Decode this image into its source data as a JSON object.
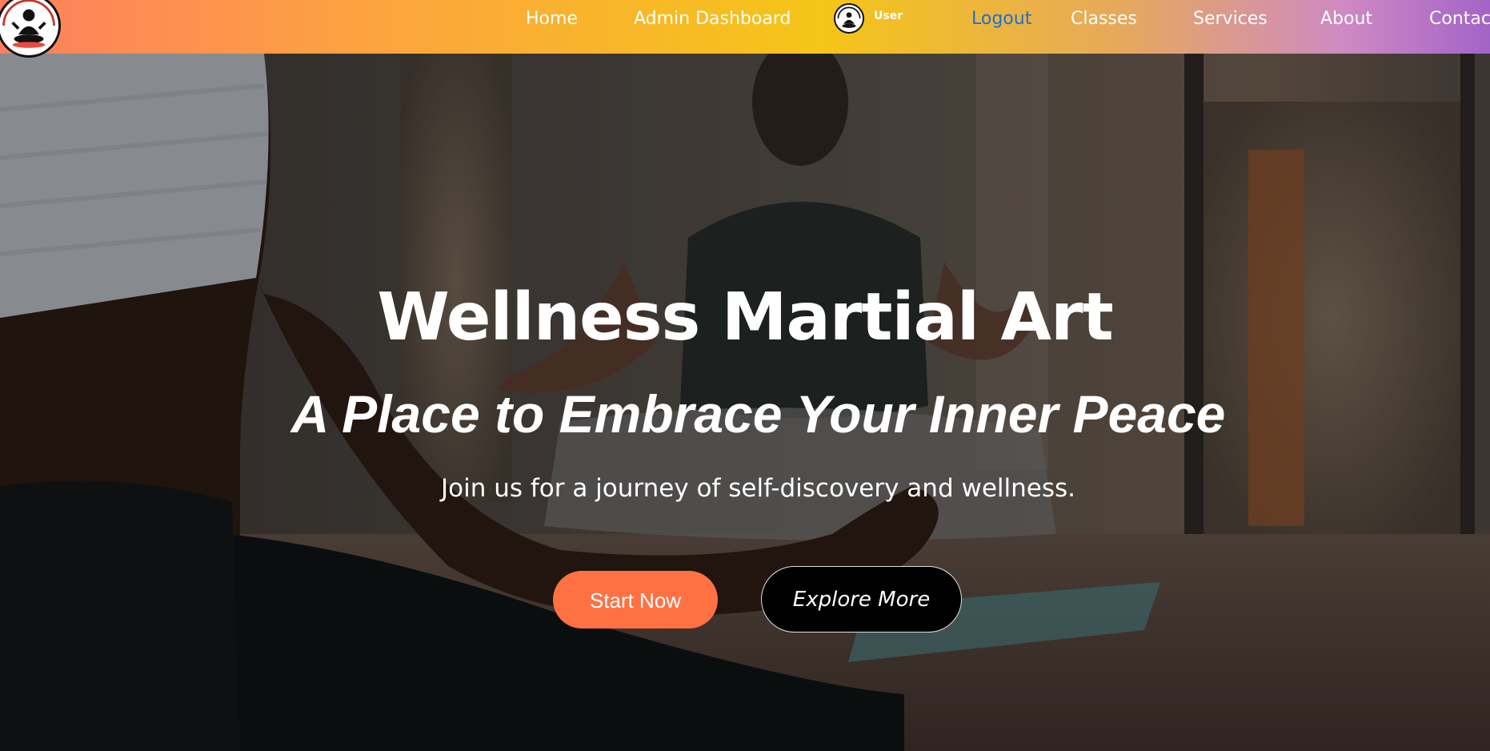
{
  "nav": {
    "logo_icon": "meditation-logo-icon",
    "links": {
      "home": "Home",
      "admin_dashboard": "Admin Dashboard",
      "user": "User",
      "logout": "Logout",
      "classes": "Classes",
      "services": "Services",
      "about": "About",
      "contact": "Contac"
    },
    "user_avatar_icon": "user-avatar-icon",
    "logout_color": "#1c6fd6"
  },
  "hero": {
    "title": "Wellness Martial Art",
    "subtitle": "A Place to Embrace Your Inner Peace",
    "description": "Join us for a journey of self-discovery and wellness.",
    "start_button": "Start Now",
    "explore_button": "Explore More",
    "background_icon": "yoga-meditation-background-image"
  },
  "colors": {
    "nav_gradient_start": "#ff7e5f",
    "nav_gradient_mid": "#f5c518",
    "nav_gradient_end": "#a364c8",
    "start_button": "#ff7142",
    "explore_button": "#000000"
  }
}
